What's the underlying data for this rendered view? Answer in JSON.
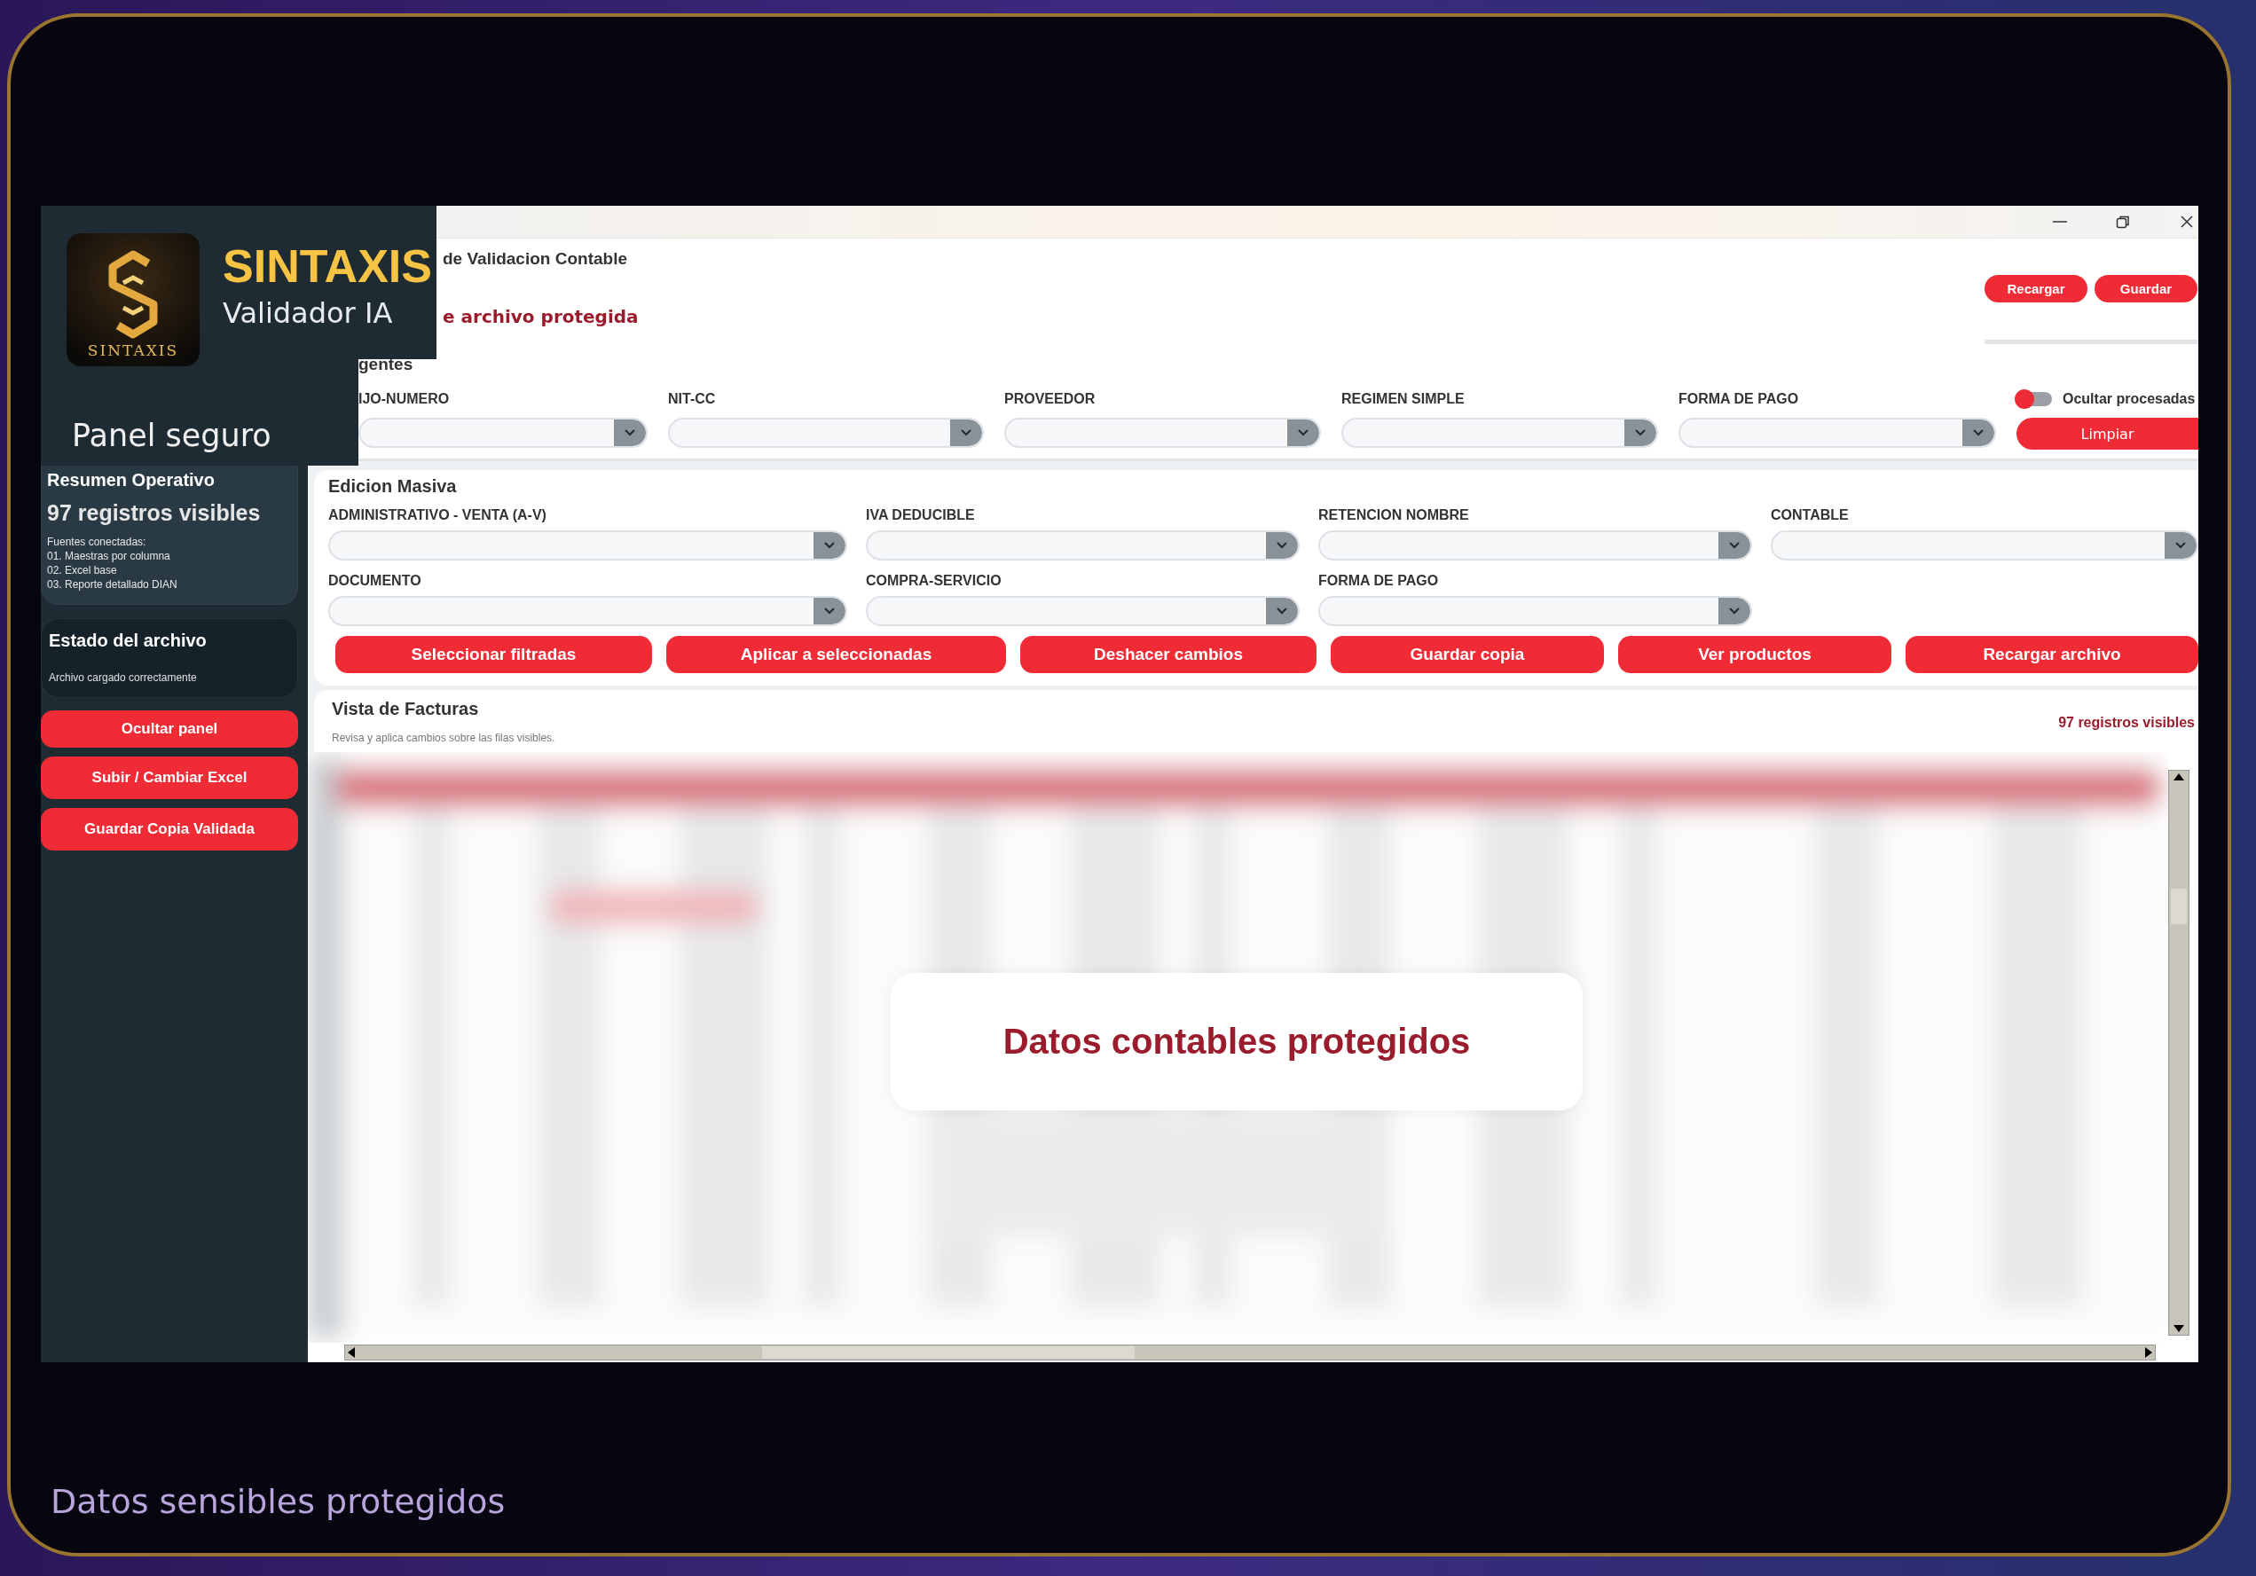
{
  "brand": {
    "logo_text": "SINTAXIS",
    "name": "SINTAXIS",
    "subtitle": "Validador IA"
  },
  "sidebar": {
    "title": "Panel seguro",
    "summary": {
      "title": "Resumen Operativo",
      "count": "97 registros visibles",
      "sources_label": "Fuentes conectadas:",
      "sources": [
        "01. Maestras por columna",
        "02. Excel base",
        "03. Reporte detallado DIAN"
      ]
    },
    "file_status": {
      "title": "Estado del archivo",
      "message": "Archivo cargado correctamente"
    },
    "buttons": [
      "Ocultar panel",
      "Subir / Cambiar Excel",
      "Guardar Copia Validada"
    ]
  },
  "header": {
    "title": "de Validacion Contable",
    "notice": "e archivo protegida",
    "actions": [
      "Recargar",
      "Guardar"
    ]
  },
  "filters": {
    "title": "gentes",
    "fields": [
      "IJO-NUMERO",
      "NIT-CC",
      "PROVEEDOR",
      "REGIMEN SIMPLE",
      "FORMA DE PAGO"
    ],
    "toggle": {
      "label": "Ocultar procesadas",
      "on": false
    },
    "clear_button": "Limpiar"
  },
  "bulk_edit": {
    "title": "Edicion Masiva",
    "fields": [
      "ADMINISTRATIVO - VENTA (A-V)",
      "IVA DEDUCIBLE",
      "RETENCION NOMBRE",
      "CONTABLE",
      "DOCUMENTO",
      "COMPRA-SERVICIO",
      "FORMA DE PAGO"
    ],
    "buttons": [
      "Seleccionar filtradas",
      "Aplicar a seleccionadas",
      "Deshacer cambios",
      "Guardar copia",
      "Ver productos",
      "Recargar archivo"
    ]
  },
  "invoices": {
    "title": "Vista de Facturas",
    "subtitle": "Revisa y aplica cambios sobre las filas visibles.",
    "count": "97 registros visibles",
    "overlay": "Datos contables protegidos"
  },
  "caption": "Datos sensibles protegidos"
}
